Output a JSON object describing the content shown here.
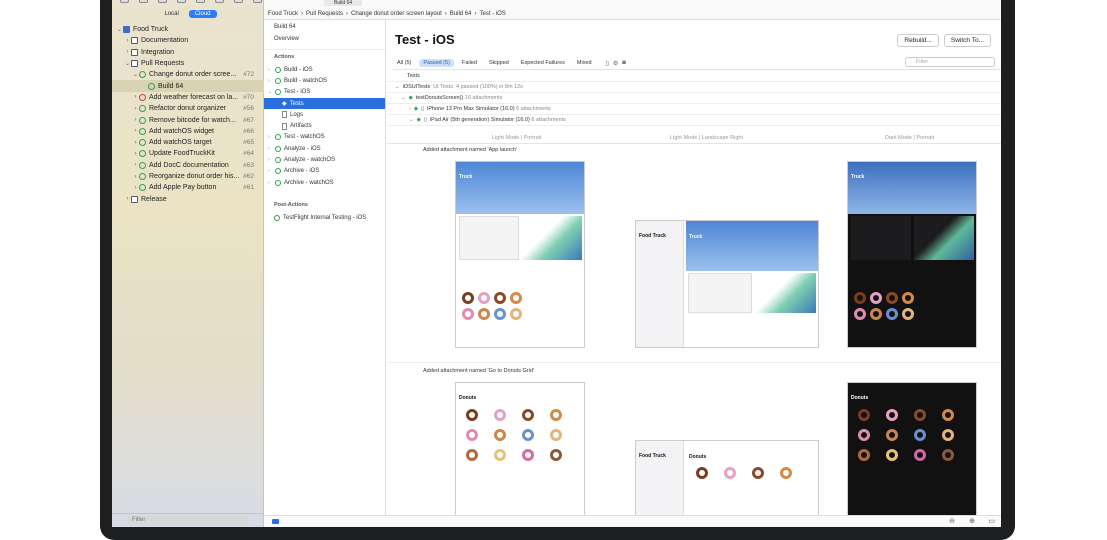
{
  "navigator": {
    "scope_local": "Local",
    "scope_cloud": "Cloud",
    "root": "Food Truck",
    "items": [
      {
        "label": "Documentation"
      },
      {
        "label": "Integration"
      },
      {
        "label": "Pull Requests"
      },
      {
        "label": "Change donut order scree...",
        "num": "#72"
      },
      {
        "label": "Build 64"
      },
      {
        "label": "Add weather forecast on la...",
        "num": "#70"
      },
      {
        "label": "Refactor donut organizer",
        "num": "#56"
      },
      {
        "label": "Remove bitcode for watch...",
        "num": "#67"
      },
      {
        "label": "Add watchOS widget",
        "num": "#66"
      },
      {
        "label": "Add watchOS target",
        "num": "#65"
      },
      {
        "label": "Update FoodTruckKit",
        "num": "#64"
      },
      {
        "label": "Add DocC documentation",
        "num": "#63"
      },
      {
        "label": "Reorganize donut order his...",
        "num": "#62"
      },
      {
        "label": "Add Apple Pay button",
        "num": "#61"
      },
      {
        "label": "Release"
      }
    ],
    "filter_placeholder": "Filter"
  },
  "breadcrumb": [
    "Food Truck",
    "Pull Requests",
    "Change donut order screen layout",
    "Build 64",
    "Test - iOS"
  ],
  "tab_title": "Build 64",
  "middle": {
    "header": "Build 64",
    "overview": "Overview",
    "actions_label": "Actions",
    "actions": [
      "Build - iOS",
      "Build - watchOS",
      "Test - iOS",
      "Tests",
      "Logs",
      "Artifacts",
      "Test - watchOS",
      "Analyze - iOS",
      "Analyze - watchOS",
      "Archive - iOS",
      "Archive - watchOS"
    ],
    "post_label": "Post-Actions",
    "post": "TestFlight Internal Testing - iOS"
  },
  "main": {
    "title": "Test - iOS",
    "rebuild": "Rebuild...",
    "switch": "Switch To...",
    "filters": [
      "All (5)",
      "Passed (5)",
      "Failed",
      "Skipped",
      "Expected Failures",
      "Mixed"
    ],
    "filter_placeholder": "Filter",
    "tests_header": "Tests",
    "suite": "iOSUITests",
    "suite_kind": "UI Tests",
    "suite_summary": "4 passed (100%) in 8m 12s",
    "test_name": "testDonutsScreen()",
    "test_attachments": "16 attachments",
    "device1": "iPhone 13 Pro Max Simulator (16.0)",
    "device1_att": "6 attachments",
    "device2": "iPad Air (5th generation) Simulator (16.0)",
    "device2_att": "6 attachments",
    "col1": "Light Mode | Portrait",
    "col2": "Light Mode | Landscape Right",
    "col3": "Dark Mode | Portrait",
    "att1": "Added attachment named 'App launch'",
    "att2": "Added attachment named 'Go to Donuts Grid'",
    "shot_truck": "Truck",
    "shot_food_truck": "Food Truck",
    "shot_donuts": "Donuts"
  }
}
